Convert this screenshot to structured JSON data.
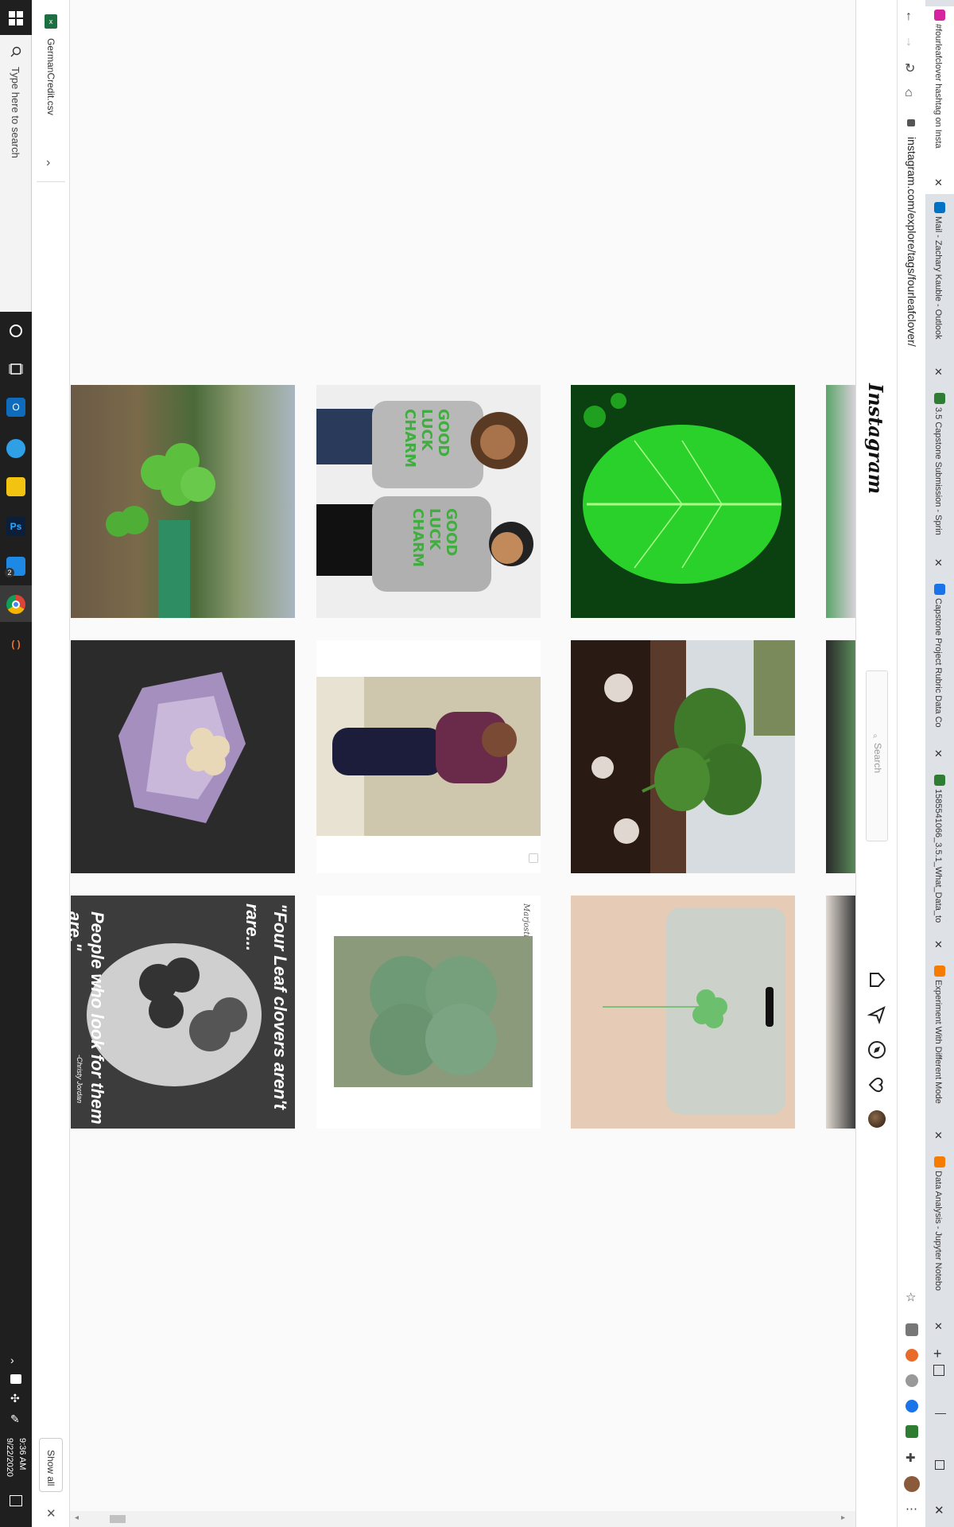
{
  "taskbar": {
    "search_placeholder": "Type here to search",
    "time": "9:36 AM",
    "date": "9/22/2020",
    "edge_badge": "2"
  },
  "downloads": {
    "file_name": "GermanCredit.csv",
    "show_all": "Show all"
  },
  "browser": {
    "url": "instagram.com/explore/tags/fourleafclover/",
    "tabs": [
      {
        "title": "#fourleafclover hashtag on Insta",
        "color": "#d6249f"
      },
      {
        "title": "Mail - Zachary Kauble - Outlook",
        "color": "#0072c6"
      },
      {
        "title": "3.5 Capstone Submission - Sprin",
        "color": "#2e7d32"
      },
      {
        "title": "Capstone Project Rubric Data Co",
        "color": "#1a73e8"
      },
      {
        "title": "1585541066_3.5.1_What_Data_to",
        "color": "#2e7d32"
      },
      {
        "title": "Experiment With Different Mode",
        "color": "#f57c00"
      },
      {
        "title": "Data Analysis - Jupyter Notebo",
        "color": "#f57c00"
      }
    ]
  },
  "instagram": {
    "logo": "Instagram",
    "search_placeholder": "Search"
  },
  "posts": {
    "tshirt_text": "GOOD LUCK CHARM",
    "quote_line1": "\"Four Leaf clovers aren't",
    "quote_line2": "rare...",
    "quote_line3": "People who look for them",
    "quote_line4": "are.\"",
    "quote_author": "-Christy Jordan",
    "signature": "Marjostime"
  }
}
